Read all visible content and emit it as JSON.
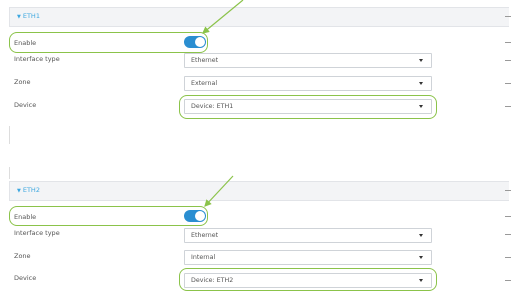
{
  "sections": [
    {
      "title": "ETH1",
      "enable_label": "Enable",
      "interface_type_label": "Interface type",
      "interface_type_value": "Ethernet",
      "zone_label": "Zone",
      "zone_value": "External",
      "device_label": "Device",
      "device_value": "Device: ETH1",
      "enabled": true
    },
    {
      "title": "ETH2",
      "enable_label": "Enable",
      "interface_type_label": "Interface type",
      "interface_type_value": "Ethernet",
      "zone_label": "Zone",
      "zone_value": "Internal",
      "device_label": "Device",
      "device_value": "Device: ETH2",
      "enabled": true
    }
  ],
  "colors": {
    "accent": "#3ca7e0",
    "toggle_on": "#2a8ed1",
    "highlight": "#8bc34a"
  },
  "icons": {
    "collapse": "triangle-down-icon",
    "dropdown": "chevron-down-icon",
    "remove": "dash-icon"
  }
}
